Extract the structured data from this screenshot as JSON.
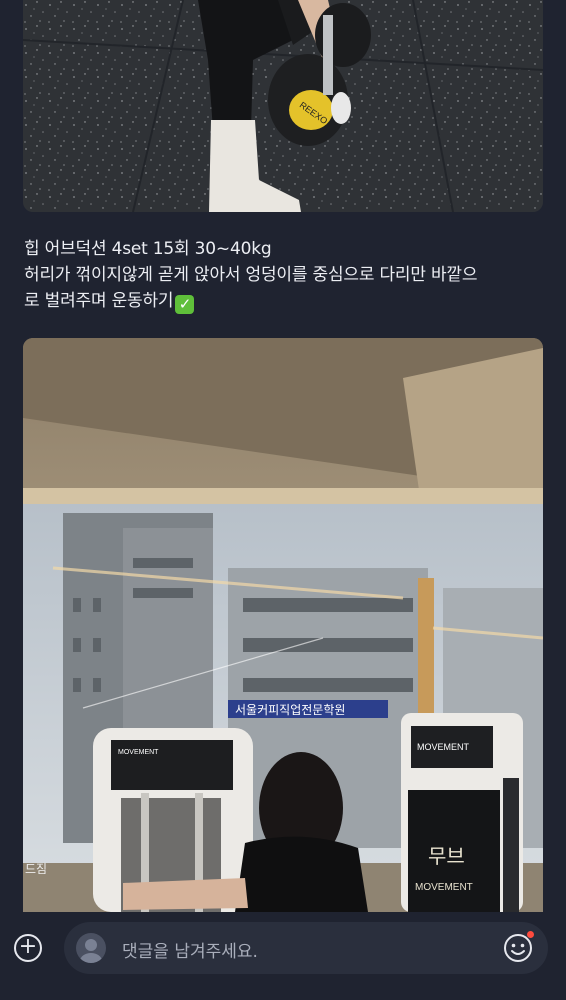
{
  "post": {
    "caption_line1": "힙 어브덕션 4set 15회 30~40kg",
    "caption_line2": "허리가 꺾이지않게 곧게 앉아서 엉덩이를 중심으로 다리만 바깥으",
    "caption_line3": "로 벌려주며 운동하기",
    "caption_emoji": "✓"
  },
  "photo_top": {
    "dumbbell_brand": "REEXO"
  },
  "photo_bottom": {
    "building_sign": "서울커피직업전문학원",
    "machine_left_brand": "MOVEMENT",
    "machine_right_brand": "MOVEMENT",
    "machine_right_logo": "무브",
    "machine_right_text": "MOVEMENT",
    "street_sign": "드짐"
  },
  "comment": {
    "placeholder": "댓글을 남겨주세요."
  },
  "icons": {
    "add": "plus-circle-icon",
    "avatar": "user-avatar-icon",
    "emoji": "smile-icon"
  },
  "colors": {
    "background": "#1f2330",
    "input_bg": "#2a2f3d",
    "check_green": "#5fbf3a",
    "notification_dot": "#ff4b3e"
  }
}
